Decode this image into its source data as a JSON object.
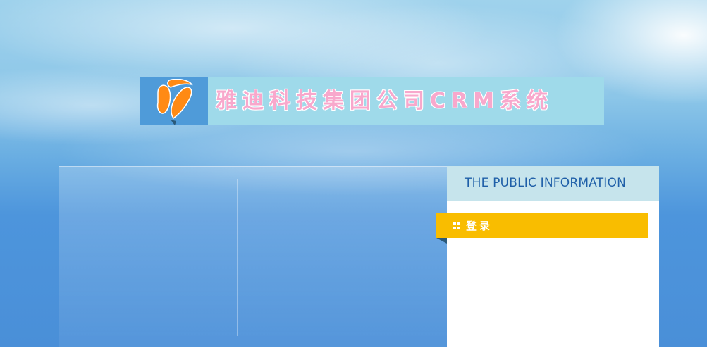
{
  "header": {
    "title": "雅迪科技集团公司CRM系统",
    "logo_icon": "company-logo-icon"
  },
  "info_panel": {
    "title": "THE PUBLIC INFORMATION"
  },
  "login": {
    "label": "登录",
    "icon": "grid-icon",
    "color": "#f9bd00"
  },
  "colors": {
    "banner_bg": "#9fdaea",
    "logo_bg": "#4f9bd9",
    "title_text": "#f8a8cc",
    "info_title_text": "#1f5fa8"
  }
}
